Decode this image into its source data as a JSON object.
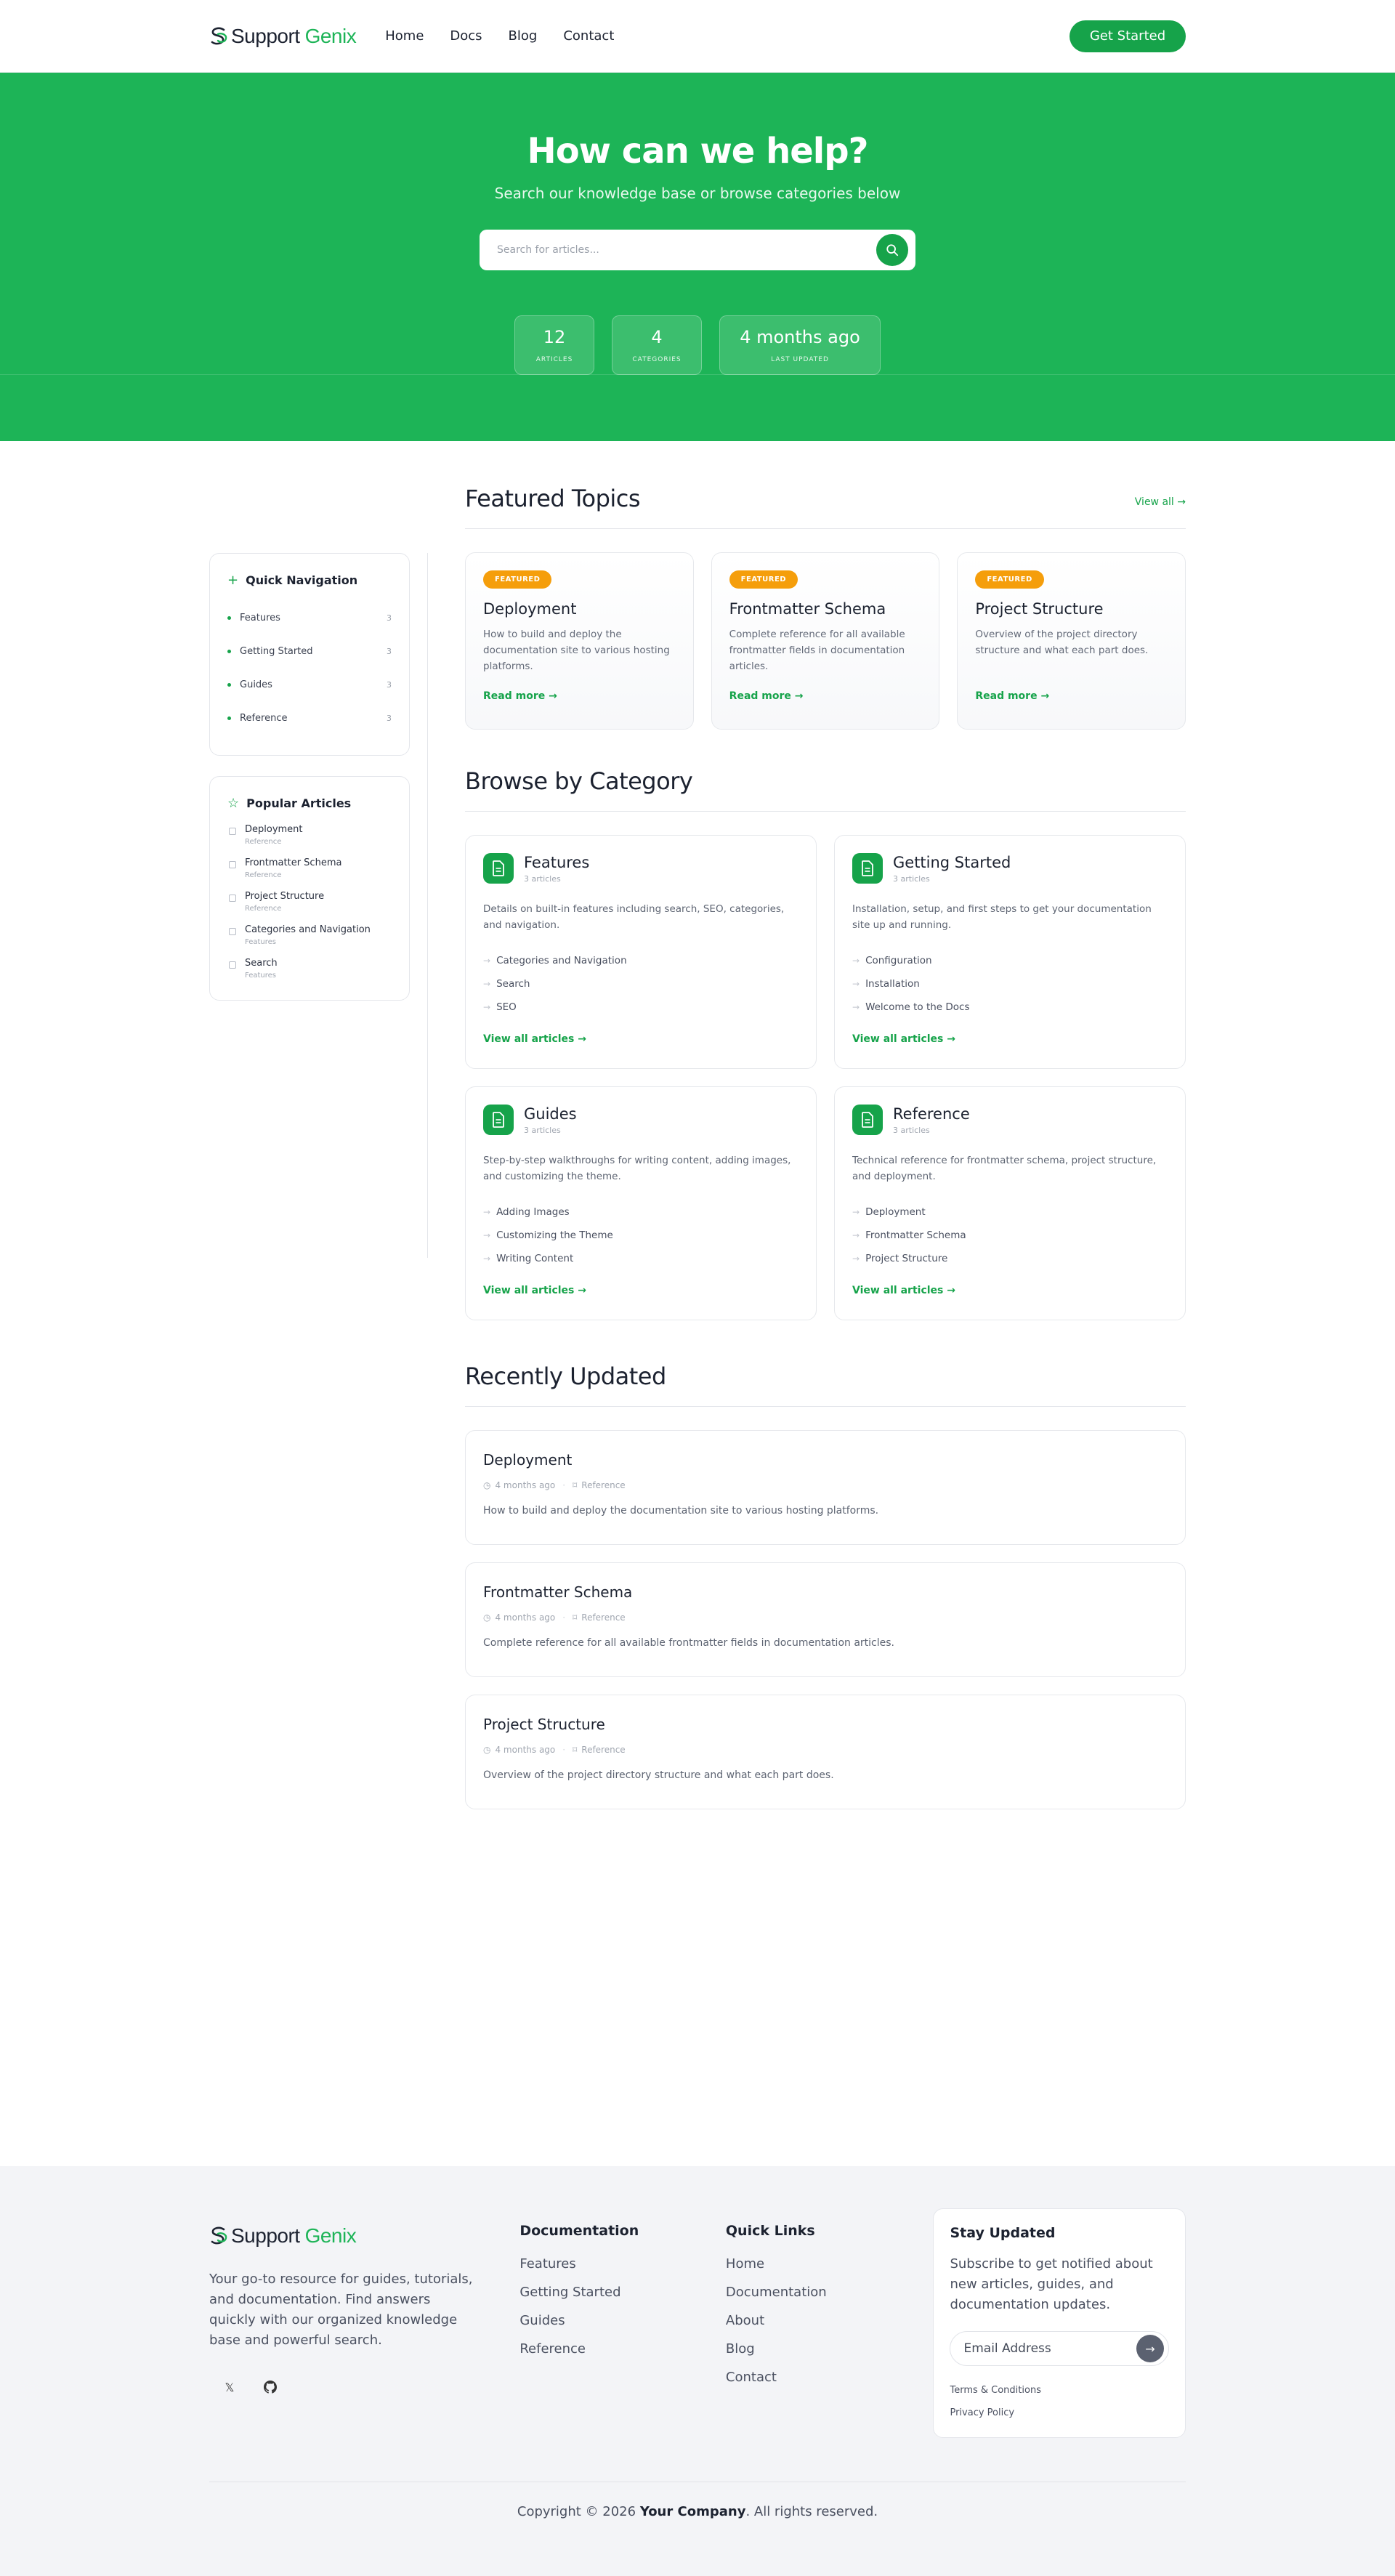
{
  "brand": {
    "part1": "Support",
    "part2": "Genix"
  },
  "nav": {
    "items": [
      "Home",
      "Docs",
      "Blog",
      "Contact"
    ],
    "cta": "Get Started"
  },
  "hero": {
    "title": "How can we help?",
    "subtitle": "Search our knowledge base or browse categories below",
    "search_placeholder": "Search for articles...",
    "stats": [
      {
        "value": "12",
        "label": "Articles"
      },
      {
        "value": "4",
        "label": "Categories"
      },
      {
        "value": "4 months ago",
        "label": "Last Updated"
      }
    ]
  },
  "sidebar": {
    "quick_nav": {
      "title": "Quick Navigation",
      "items": [
        {
          "label": "Features",
          "count": "3"
        },
        {
          "label": "Getting Started",
          "count": "3"
        },
        {
          "label": "Guides",
          "count": "3"
        },
        {
          "label": "Reference",
          "count": "3"
        }
      ]
    },
    "popular": {
      "title": "Popular Articles",
      "items": [
        {
          "title": "Deployment",
          "category": "Reference"
        },
        {
          "title": "Frontmatter Schema",
          "category": "Reference"
        },
        {
          "title": "Project Structure",
          "category": "Reference"
        },
        {
          "title": "Categories and Navigation",
          "category": "Features"
        },
        {
          "title": "Search",
          "category": "Features"
        }
      ]
    }
  },
  "featured": {
    "title": "Featured Topics",
    "view_all": "View all →",
    "cards": [
      {
        "badge": "FEATURED",
        "title": "Deployment",
        "desc": "How to build and deploy the documentation site to various hosting platforms.",
        "link": "Read more →"
      },
      {
        "badge": "FEATURED",
        "title": "Frontmatter Schema",
        "desc": "Complete reference for all available frontmatter fields in documentation articles.",
        "link": "Read more →"
      },
      {
        "badge": "FEATURED",
        "title": "Project Structure",
        "desc": "Overview of the project directory structure and what each part does.",
        "link": "Read more →"
      }
    ]
  },
  "categories": {
    "title": "Browse by Category",
    "cards": [
      {
        "name": "Features",
        "count": "3 articles",
        "desc": "Details on built-in features including search, SEO, categories, and navigation.",
        "articles": [
          "Categories and Navigation",
          "Search",
          "SEO"
        ],
        "link": "View all articles →"
      },
      {
        "name": "Getting Started",
        "count": "3 articles",
        "desc": "Installation, setup, and first steps to get your documentation site up and running.",
        "articles": [
          "Configuration",
          "Installation",
          "Welcome to the Docs"
        ],
        "link": "View all articles →"
      },
      {
        "name": "Guides",
        "count": "3 articles",
        "desc": "Step-by-step walkthroughs for writing content, adding images, and customizing the theme.",
        "articles": [
          "Adding Images",
          "Customizing the Theme",
          "Writing Content"
        ],
        "link": "View all articles →"
      },
      {
        "name": "Reference",
        "count": "3 articles",
        "desc": "Technical reference for frontmatter schema, project structure, and deployment.",
        "articles": [
          "Deployment",
          "Frontmatter Schema",
          "Project Structure"
        ],
        "link": "View all articles →"
      }
    ]
  },
  "recent": {
    "title": "Recently Updated",
    "items": [
      {
        "title": "Deployment",
        "time": "4 months ago",
        "category": "Reference",
        "desc": "How to build and deploy the documentation site to various hosting platforms."
      },
      {
        "title": "Frontmatter Schema",
        "time": "4 months ago",
        "category": "Reference",
        "desc": "Complete reference for all available frontmatter fields in documentation articles."
      },
      {
        "title": "Project Structure",
        "time": "4 months ago",
        "category": "Reference",
        "desc": "Overview of the project directory structure and what each part does."
      }
    ]
  },
  "footer": {
    "description": "Your go-to resource for guides, tutorials, and documentation. Find answers quickly with our organized knowledge base and powerful search.",
    "docs": {
      "title": "Documentation",
      "links": [
        "Features",
        "Getting Started",
        "Guides",
        "Reference"
      ]
    },
    "quick": {
      "title": "Quick Links",
      "links": [
        "Home",
        "Documentation",
        "About",
        "Blog",
        "Contact"
      ]
    },
    "newsletter": {
      "title": "Stay Updated",
      "text": "Subscribe to get notified about new articles, guides, and documentation updates.",
      "placeholder": "Email Address",
      "terms": "Terms & Conditions",
      "privacy": "Privacy Policy"
    },
    "copyright_pre": "Copyright © 2026 ",
    "copyright_company": "Your Company",
    "copyright_post": ". All rights reserved."
  },
  "colors": {
    "brand_green": "#1db457",
    "button_green": "#16a34a",
    "badge_orange": "#f59e0b"
  }
}
